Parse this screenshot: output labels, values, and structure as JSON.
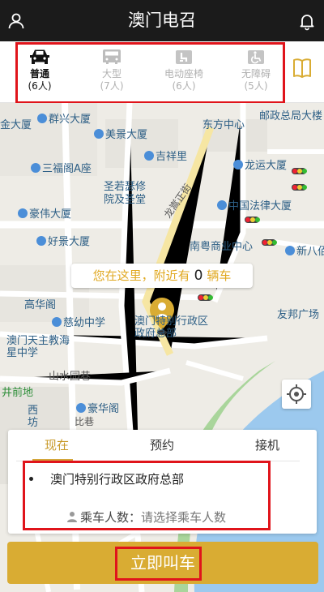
{
  "header": {
    "title": "澳门电召",
    "left_icon": "user-icon",
    "right_icon": "bell-icon"
  },
  "vehicle_tabs": [
    {
      "name": "普通",
      "capacity": "(6人)",
      "icon": "car-front-icon",
      "active": true
    },
    {
      "name": "大型",
      "capacity": "(7人)",
      "icon": "van-icon",
      "active": false
    },
    {
      "name": "电动座椅",
      "capacity": "(6人)",
      "icon": "power-seat-icon",
      "active": false
    },
    {
      "name": "无障碍",
      "capacity": "(5人)",
      "icon": "wheelchair-icon",
      "active": false
    }
  ],
  "book_icon": "book-icon",
  "map": {
    "labels": [
      "邮政总局大楼",
      "金大厦",
      "群兴大厦",
      "美景大厦",
      "东方中心",
      "吉祥里",
      "三福阁A座",
      "龙运大厦",
      "圣若瑟修院及圣堂",
      "龙嵩正街",
      "中国法律大厦",
      "豪伟大厦",
      "南粤商业中心",
      "新八佰伴",
      "好景大厦",
      "高华阁",
      "慈幼中学",
      "澳门特别行政区政府总部",
      "友邦广场",
      "澳门天主教海星中学",
      "山水园巷",
      "井前地",
      "豪华阁",
      "西坊",
      "比巷"
    ],
    "nearby_prefix": "您在这里，附近有",
    "nearby_count": "0",
    "nearby_suffix": "辆车"
  },
  "booking": {
    "tabs": [
      "现在",
      "预约",
      "接机"
    ],
    "active_tab": "现在",
    "destination": "澳门特别行政区政府总部",
    "passenger_label": "乘车人数：",
    "passenger_placeholder": "请选择乘车人数"
  },
  "call_button": "立即叫车",
  "colors": {
    "header_bg": "#1b1b1b",
    "accent": "#d9ac33",
    "highlight_box": "#e0141b"
  }
}
